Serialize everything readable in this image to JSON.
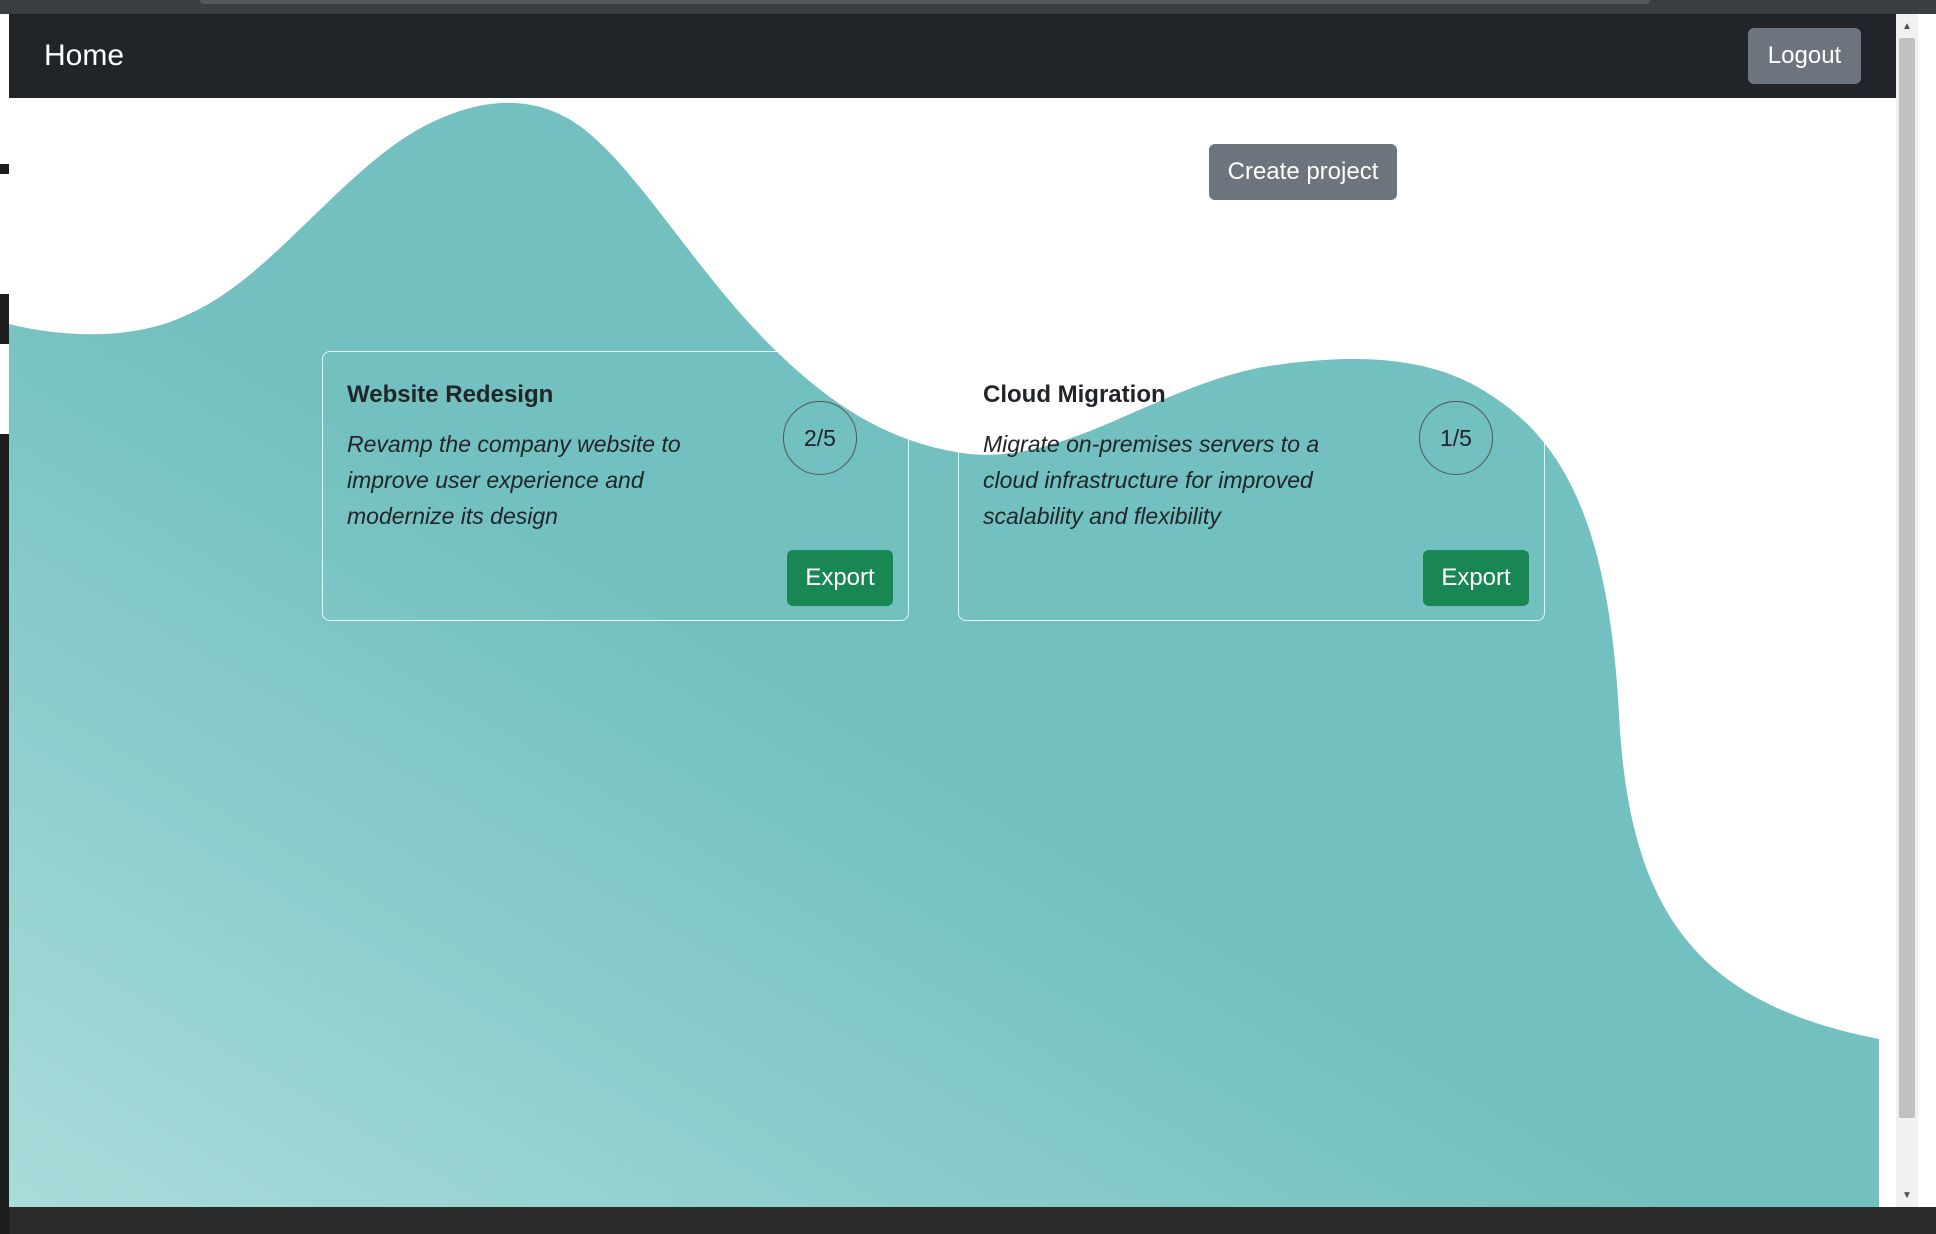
{
  "navbar": {
    "brand": "Home",
    "logout_label": "Logout"
  },
  "actions": {
    "create_project_label": "Create project"
  },
  "projects": [
    {
      "title": "Website Redesign",
      "description": "Revamp the company website to improve user experience and modernize its design",
      "progress": "2/5",
      "export_label": "Export"
    },
    {
      "title": "Cloud Migration",
      "description": "Migrate on-premises servers to a cloud infrastructure for improved scalability and flexibility",
      "progress": "1/5",
      "export_label": "Export"
    }
  ],
  "colors": {
    "navbar_bg": "#212529",
    "secondary_button": "#6c757d",
    "success_button": "#198754",
    "wave_main": "#72c0bf",
    "wave_light": "#a9dcdb"
  }
}
